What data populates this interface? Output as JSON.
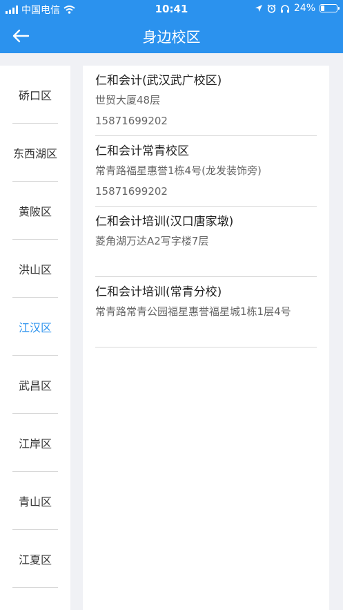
{
  "status_bar": {
    "carrier": "中国电信",
    "time": "10:41",
    "battery": "24%",
    "battery_level": 0.24
  },
  "nav": {
    "title": "身边校区",
    "back_icon": "arrow-left-icon"
  },
  "sidebar": {
    "items": [
      {
        "label": "硚口区",
        "active": false
      },
      {
        "label": "东西湖区",
        "active": false
      },
      {
        "label": "黄陂区",
        "active": false
      },
      {
        "label": "洪山区",
        "active": false
      },
      {
        "label": "江汉区",
        "active": true
      },
      {
        "label": "武昌区",
        "active": false
      },
      {
        "label": "江岸区",
        "active": false
      },
      {
        "label": "青山区",
        "active": false
      },
      {
        "label": "江夏区",
        "active": false
      }
    ]
  },
  "schools": [
    {
      "name": "仁和会计(武汉武广校区)",
      "address": "世贸大厦48层",
      "phone": "15871699202"
    },
    {
      "name": "仁和会计常青校区",
      "address": "常青路福星惠誉1栋4号(龙发装饰旁)",
      "phone": "15871699202"
    },
    {
      "name": "仁和会计培训(汉口唐家墩)",
      "address": "菱角湖万达A2写字楼7层",
      "phone": ""
    },
    {
      "name": "仁和会计培训(常青分校)",
      "address": "常青路常青公园福星惠誉福星城1栋1层4号",
      "phone": ""
    }
  ],
  "colors": {
    "accent": "#2b92ee",
    "background": "#f0f1f5"
  }
}
